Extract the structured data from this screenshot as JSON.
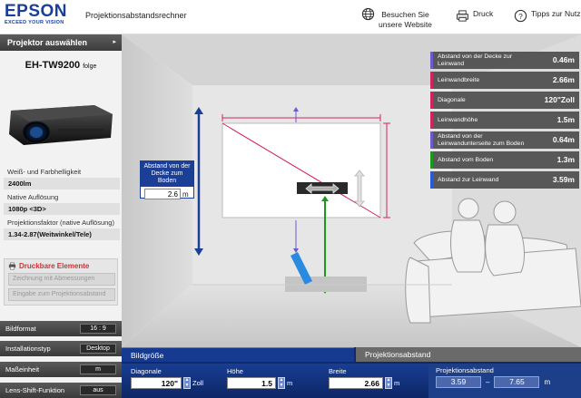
{
  "header": {
    "brand": "EPSON",
    "tagline": "EXCEED YOUR VISION",
    "app_title": "Projektionsabstandsrechner",
    "visit_line1": "Besuchen Sie",
    "visit_line2": "unsere Website",
    "print_label": "Druck",
    "tips_label": "Tipps zur Nutz"
  },
  "sidebar": {
    "select_projector_label": "Projektor auswählen",
    "model_name": "EH-TW9200",
    "model_suffix": "folge",
    "specs": [
      {
        "label": "Weiß- und Farbhelligkeit",
        "value": "2400lm"
      },
      {
        "label": "Native Auflösung",
        "value": "1080p  <3D>"
      },
      {
        "label": "Projektionsfaktor (native Auflösung)",
        "value": "1.34-2.87(Weitwinkel/Tele)"
      }
    ],
    "printable_title": "Druckbare Elemente",
    "print_with_dims": "Zeichnung mit Abmessungen",
    "print_input_dist": "Eingabe zum Projektionsabstand",
    "settings": [
      {
        "label": "Bildformat",
        "value": "16 : 9"
      },
      {
        "label": "Installationstyp",
        "value": "Desktop"
      },
      {
        "label": "Maßeinheit",
        "value": "m"
      },
      {
        "label": "Lens-Shift-Funktion",
        "value": "aus"
      }
    ]
  },
  "measurements": [
    {
      "label": "Abstand von der Decke zur Leinwand",
      "value": "0.46m",
      "color": "#6a5acd"
    },
    {
      "label": "Leinwandbreite",
      "value": "2.66m",
      "color": "#d0245c"
    },
    {
      "label": "Diagonale",
      "value": "120\"Zoll",
      "color": "#d0245c"
    },
    {
      "label": "Leinwandhöhe",
      "value": "1.5m",
      "color": "#d0245c"
    },
    {
      "label": "Abstand von der Leinwandunterseite zum Boden",
      "value": "0.64m",
      "color": "#6a5acd"
    },
    {
      "label": "Abstand vom Boden",
      "value": "1.3m",
      "color": "#1a9a1a"
    },
    {
      "label": "Abstand zur Leinwand",
      "value": "3.59m",
      "color": "#2a5ad8"
    }
  ],
  "ceiling_box": {
    "label": "Abstand von der Decke zum Boden",
    "value": "2.6",
    "unit": "m"
  },
  "bottom": {
    "tab_active": "Bildgröße",
    "tab_inactive": "Projektionsabstand",
    "diag_label": "Diagonale",
    "diag_value": "120\"",
    "diag_unit": "Zoll",
    "height_label": "Höhe",
    "height_value": "1.5",
    "height_unit": "m",
    "width_label": "Breite",
    "width_value": "2.66",
    "width_unit": "m",
    "proj_dist_label": "Projektionsabstand",
    "proj_min": "3.59",
    "proj_sep": "–",
    "proj_max": "7.65",
    "proj_unit": "m"
  }
}
